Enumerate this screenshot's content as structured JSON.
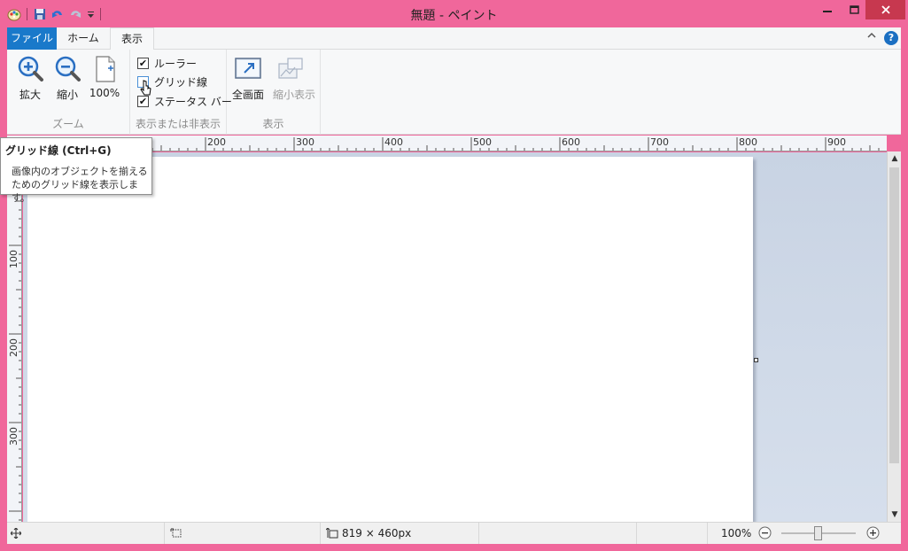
{
  "titlebar": {
    "title": "無題 - ペイント",
    "colors": {
      "frame": "#f0679b",
      "close": "#c7384f"
    }
  },
  "quick_access": {
    "icons": [
      "paint-app-icon",
      "save-icon",
      "undo-icon",
      "redo-icon",
      "customize-dropdown-icon"
    ]
  },
  "tabs": [
    {
      "label": "ファイル"
    },
    {
      "label": "ホーム"
    },
    {
      "label": "表示"
    }
  ],
  "ribbon": {
    "zoom_group": {
      "label": "ズーム",
      "zoom_in": "拡大",
      "zoom_out": "縮小",
      "zoom_100": "100%"
    },
    "show_hide_group": {
      "label": "表示または非表示",
      "ruler": {
        "label": "ルーラー",
        "checked": true
      },
      "gridlines": {
        "label": "グリッド線",
        "checked": false
      },
      "statusbar": {
        "label": "ステータス バー",
        "checked": true
      }
    },
    "display_group": {
      "label": "表示",
      "fullscreen": "全画面",
      "thumbnail": "縮小表示"
    }
  },
  "ruler": {
    "h_labels": [
      "200",
      "300",
      "400",
      "500",
      "600",
      "700",
      "800",
      "900"
    ],
    "v_labels": [
      "100",
      "200",
      "300"
    ]
  },
  "tooltip": {
    "title": "グリッド線 (Ctrl+G)",
    "description": "画像内のオブジェクトを揃えるためのグリッド線を表示します。"
  },
  "statusbar": {
    "canvas_size": "819 × 460px",
    "zoom_level": "100%",
    "zoom_fraction": 0.5
  }
}
